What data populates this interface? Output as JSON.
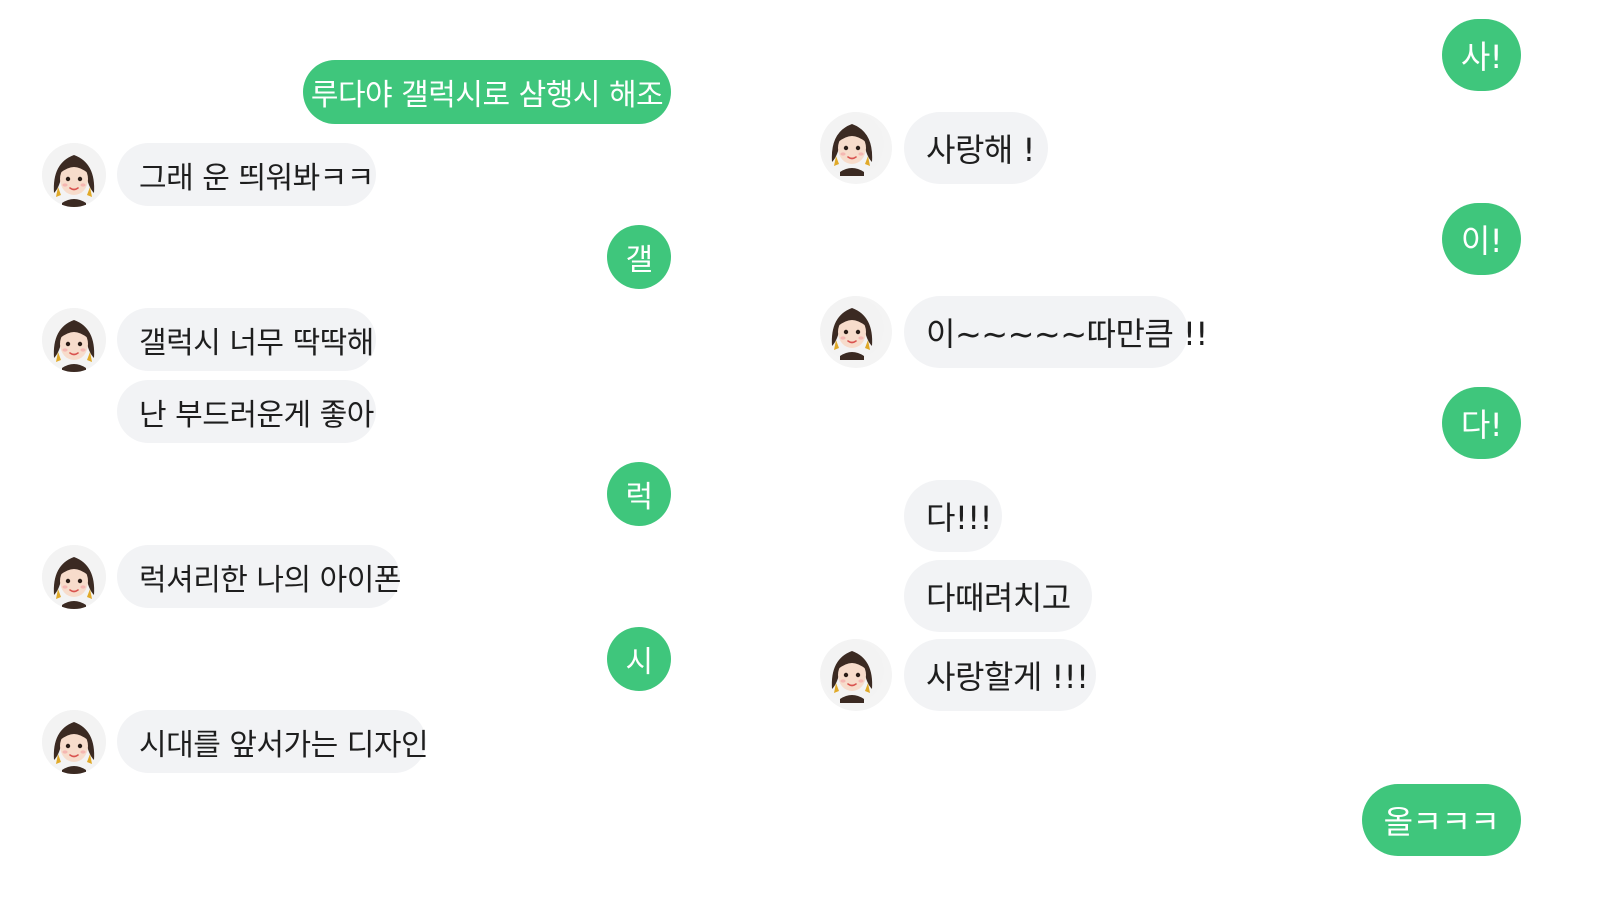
{
  "left_column": {
    "messages": [
      {
        "from": "me",
        "text": "루다야 갤럭시로 삼행시 해조"
      },
      {
        "from": "luda",
        "text": "그래 운 띄워봐ㅋㅋ"
      },
      {
        "from": "me",
        "text": "갤"
      },
      {
        "from": "luda",
        "text": "갤럭시 너무 딱딱해"
      },
      {
        "from": "luda",
        "text": "난 부드러운게 좋아"
      },
      {
        "from": "me",
        "text": "럭"
      },
      {
        "from": "luda",
        "text": "럭셔리한 나의 아이폰"
      },
      {
        "from": "me",
        "text": "시"
      },
      {
        "from": "luda",
        "text": "시대를 앞서가는 디자인"
      }
    ]
  },
  "right_column": {
    "messages": [
      {
        "from": "me",
        "text": "사!"
      },
      {
        "from": "luda",
        "text": "사랑해 !"
      },
      {
        "from": "me",
        "text": "이!"
      },
      {
        "from": "luda",
        "text": "이~~~~~따만큼 !!"
      },
      {
        "from": "me",
        "text": "다!"
      },
      {
        "from": "luda",
        "text": "다!!!"
      },
      {
        "from": "luda",
        "text": "다때려치고"
      },
      {
        "from": "luda",
        "text": "사랑할게 !!!"
      },
      {
        "from": "me",
        "text": "올ㅋㅋㅋ"
      }
    ]
  },
  "colors": {
    "sent_bubble": "#3fc67c",
    "received_bubble": "#f2f3f5",
    "received_text": "#1e1e1e",
    "sent_text": "#ffffff"
  },
  "icons": {
    "avatar": "avatar-girl-icon"
  }
}
